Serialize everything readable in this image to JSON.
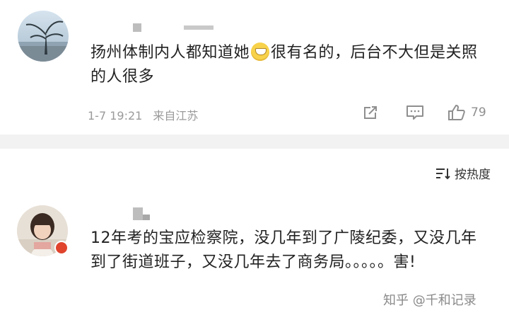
{
  "comments": [
    {
      "text_before_emoji": "扬州体制内人都知道她",
      "text_after_emoji": "很有名的，后台不大但是关照的人很多",
      "emoji": "grinning-face-icon",
      "date": "1-7 19:21",
      "location": "来自江苏",
      "likes": "79"
    },
    {
      "text": "12年考的宝应检察院，没几年到了广陵纪委，又没几年到了街道班子，又没几年去了商务局。。。。。害!"
    }
  ],
  "sort": {
    "label": "按热度"
  },
  "watermark": "知乎 @千和记录",
  "colors": {
    "text": "#222222",
    "meta": "#9a9a9a",
    "badge": "#e0442d"
  }
}
